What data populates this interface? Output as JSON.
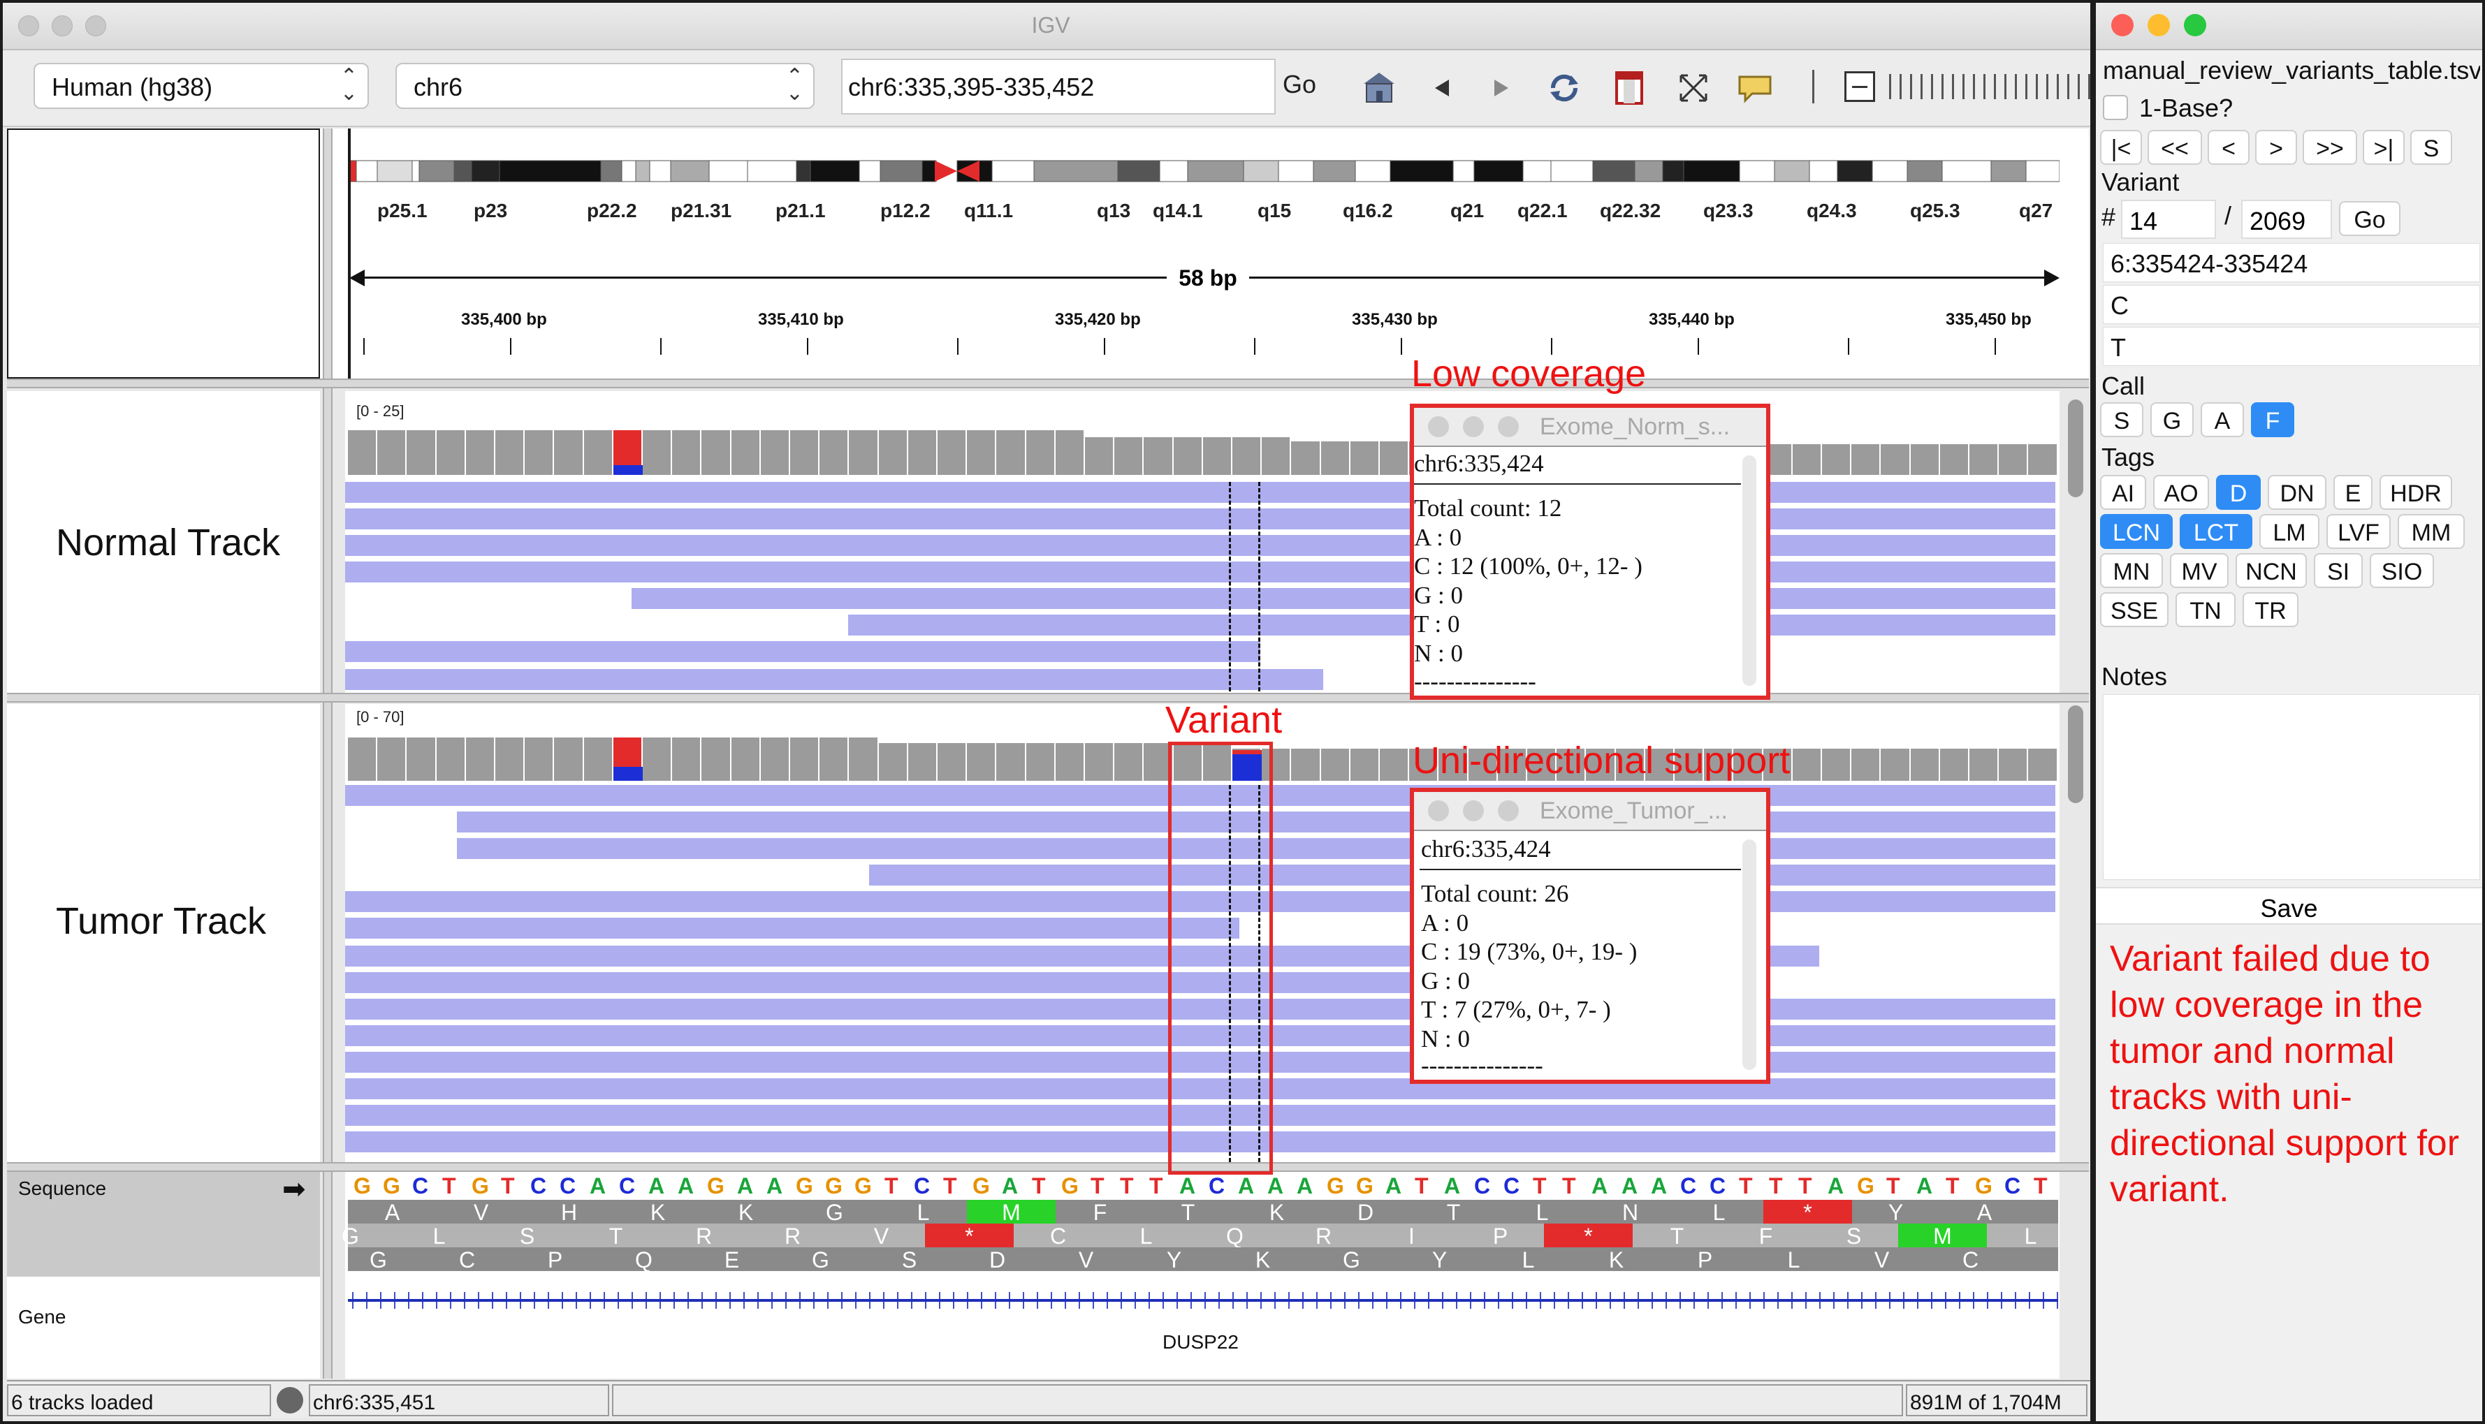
{
  "igv": {
    "window_title": "IGV",
    "genome": "Human (hg38)",
    "chromosome": "chr6",
    "locus": "chr6:335,395-335,452",
    "go_label": "Go",
    "cytobands": [
      "p25.1",
      "p23",
      "p22.2",
      "p21.31",
      "p21.1",
      "p12.2",
      "q11.1",
      "q13",
      "q14.1",
      "q15",
      "q16.2",
      "q21",
      "q22.1",
      "q22.32",
      "q23.3",
      "q24.3",
      "q25.3",
      "q27"
    ],
    "span_label": "58 bp",
    "ruler_ticks": [
      "335,400 bp",
      "335,410 bp",
      "335,420 bp",
      "335,430 bp",
      "335,440 bp",
      "335,450 bp"
    ],
    "normal_track": {
      "name": "Normal Track",
      "range": "[0 - 25]"
    },
    "tumor_track": {
      "name": "Tumor Track",
      "range": "[0 - 70]"
    },
    "sequence_label": "Sequence",
    "gene_label": "Gene",
    "gene_name": "DUSP22",
    "sequence": "GGCTGTCCACAAGAAGGGTCTGATGTTTACAAAGGATACCTTAAACCTTTAGTATGCT",
    "aa_frame1": [
      "A",
      "V",
      "H",
      "K",
      "K",
      "G",
      "L",
      "M",
      "F",
      "T",
      "K",
      "D",
      "T",
      "L",
      "N",
      "L",
      "*",
      "Y",
      "A"
    ],
    "aa_frame2": [
      "G",
      "L",
      "S",
      "T",
      "R",
      "R",
      "V",
      "*",
      "C",
      "L",
      "Q",
      "R",
      "I",
      "P",
      "*",
      "T",
      "F",
      "S",
      "M",
      "L"
    ],
    "aa_frame3": [
      "G",
      "C",
      "P",
      "Q",
      "E",
      "G",
      "S",
      "D",
      "V",
      "Y",
      "K",
      "G",
      "Y",
      "L",
      "K",
      "P",
      "L",
      "V",
      "C"
    ],
    "status": {
      "tracks_loaded": "6 tracks loaded",
      "position": "chr6:335,451",
      "memory": "891M of 1,704M"
    },
    "popup_normal": {
      "title": "Exome_Norm_s...",
      "lines": [
        "chr6:335,424",
        "Total count: 12",
        "A : 0",
        "C : 12 (100%, 0+, 12- )",
        "G : 0",
        "T : 0",
        "N : 0",
        "---------------"
      ]
    },
    "popup_tumor": {
      "title": "Exome_Tumor_...",
      "lines": [
        "chr6:335,424",
        "Total count: 26",
        "A : 0",
        "C : 19 (73%, 0+, 19- )",
        "G : 0",
        "T : 7 (27%, 0+, 7- )",
        "N : 0",
        "---------------"
      ]
    },
    "annotations": {
      "low_coverage": "Low coverage",
      "variant": "Variant",
      "uni_directional": "Uni-directional support"
    },
    "read_bases": {
      "c": "C",
      "t": "T",
      "n": "N"
    }
  },
  "review": {
    "file_name": "manual_review_variants_table.tsv",
    "one_base_label": "1-Base?",
    "nav_buttons": [
      "|<",
      "<<",
      "<",
      ">",
      ">>",
      ">|",
      "S"
    ],
    "variant_label": "Variant",
    "hash": "#",
    "variant_index": "14",
    "slash": "/",
    "variant_total": "2069",
    "go_label": "Go",
    "variant_locus": "6:335424-335424",
    "ref_allele": "C",
    "alt_allele": "T",
    "call_label": "Call",
    "call_options": [
      "S",
      "G",
      "A",
      "F"
    ],
    "call_selected": "F",
    "tags_label": "Tags",
    "tags": [
      "AI",
      "AO",
      "D",
      "DN",
      "E",
      "HDR",
      "LCN",
      "LCT",
      "LM",
      "LVF",
      "MM",
      "MN",
      "MV",
      "NCN",
      "SI",
      "SIO",
      "SSE",
      "TN",
      "TR"
    ],
    "tags_selected": [
      "D",
      "LCN",
      "LCT"
    ],
    "notes_label": "Notes",
    "save_label": "Save",
    "explanation": "Variant failed due to low coverage in the tumor and normal tracks with uni-directional support for variant."
  },
  "colors": {
    "accent_red": "#e32b2b",
    "read": "#adadf0",
    "selected": "#2f8cf5"
  }
}
